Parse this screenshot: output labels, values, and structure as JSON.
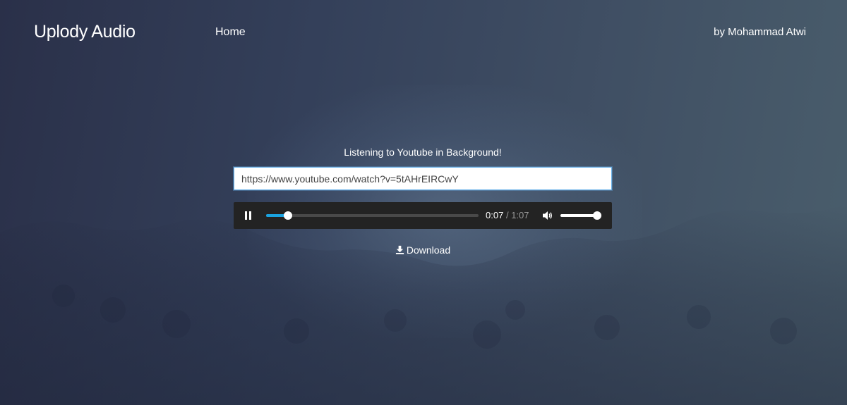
{
  "header": {
    "brand": "Uplody Audio",
    "nav_home": "Home",
    "author": "by Mohammad Atwi"
  },
  "main": {
    "heading": "Listening to Youtube in Background!",
    "url_value": "https://www.youtube.com/watch?v=5tAHrEIRCwY",
    "download_label": "Download"
  },
  "player": {
    "state": "playing",
    "current_time": "0:07",
    "separator": "/",
    "duration": "1:07",
    "progress_fraction": 0.104,
    "volume_fraction": 1.0
  },
  "colors": {
    "accent": "#1aa3e0",
    "player_bg": "#232323",
    "input_border": "#66afe9"
  },
  "icons": {
    "play_button": "pause-icon",
    "volume_button": "volume-icon",
    "download": "download-icon"
  }
}
